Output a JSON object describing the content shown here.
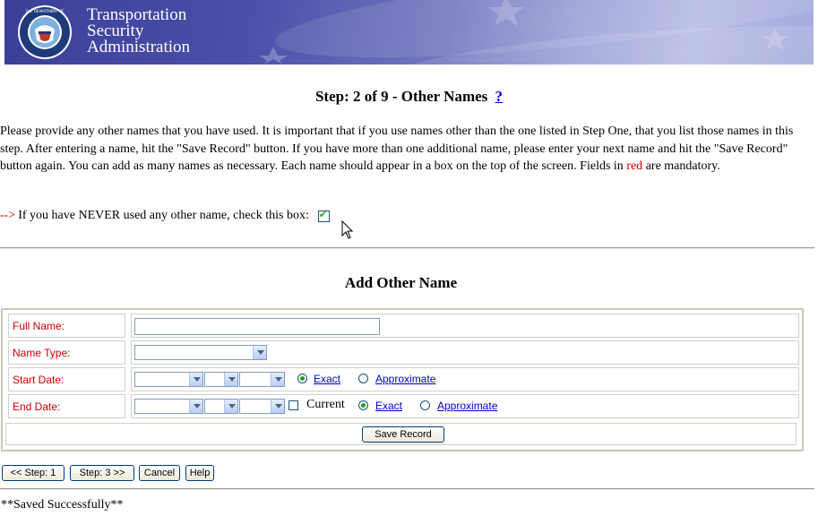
{
  "header": {
    "agency_line1": "Transportation",
    "agency_line2": "Security",
    "agency_line3": "Administration"
  },
  "step": {
    "title": "Step: 2 of 9 - Other Names",
    "help_link": "?"
  },
  "intro": {
    "text_before_red": "Please provide any other names that you have used. It is important that if you use names other than the one listed in Step One, that you list those names in this step. After entering a name, hit the \"Save Record\" button. If you have more than one additional name, please enter your next name and hit the \"Save Record\" button again. You can add as many names as necessary. Each name should appear in a box on the top of the screen. Fields in ",
    "red_word": "red",
    "text_after_red": " are mandatory."
  },
  "never_used": {
    "arrow": "-->",
    "label": "If you have NEVER used any other name, check this box:",
    "checked": true
  },
  "form": {
    "section_title": "Add Other Name",
    "full_name_label": "Full Name:",
    "full_name_value": "",
    "name_type_label": "Name Type:",
    "name_type_value": "",
    "start_date_label": "Start Date:",
    "end_date_label": "End Date:",
    "current_label": "Current",
    "exact_label": "Exact",
    "approximate_label": "Approximate",
    "start_date_mode": "Exact",
    "end_date_mode": "Exact",
    "save_button": "Save Record"
  },
  "nav": {
    "prev_button": "<< Step: 1",
    "next_button": "Step: 3 >>",
    "cancel_button": "Cancel",
    "help_button": "Help"
  },
  "status": {
    "message": "**Saved Successfully**"
  },
  "colors": {
    "required_label": "#cc0000",
    "link": "#0000cc",
    "checkmark": "#21a121"
  }
}
